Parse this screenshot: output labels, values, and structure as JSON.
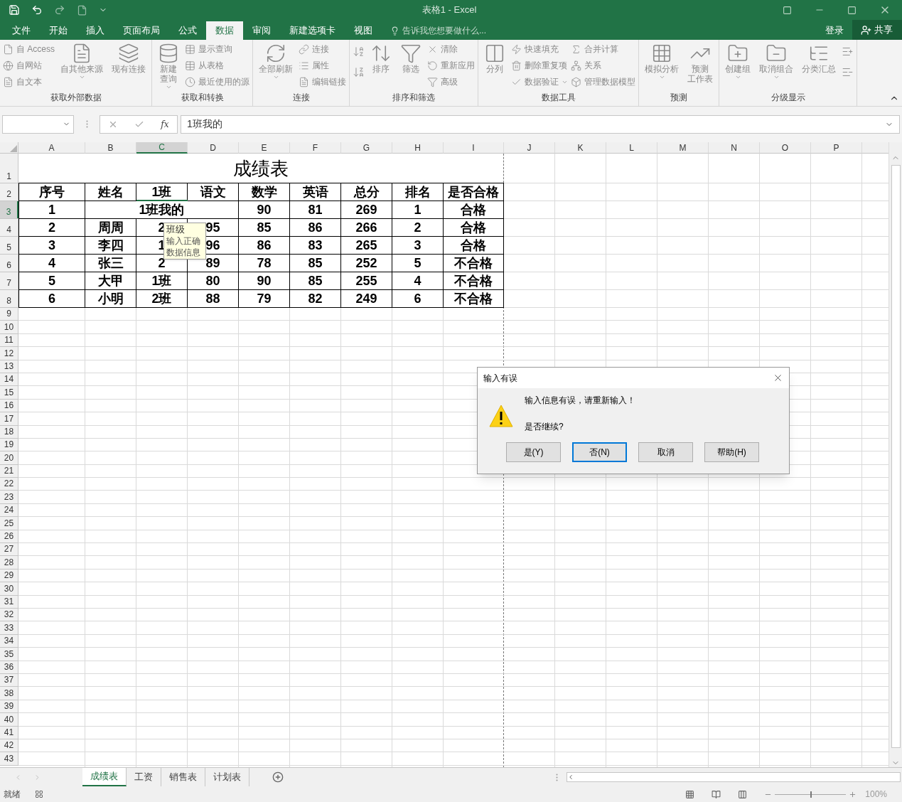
{
  "window": {
    "title": "表格1 - Excel"
  },
  "ribbon_tabs": [
    {
      "label": "文件",
      "selected": false
    },
    {
      "label": "开始",
      "selected": false
    },
    {
      "label": "插入",
      "selected": false
    },
    {
      "label": "页面布局",
      "selected": false
    },
    {
      "label": "公式",
      "selected": false
    },
    {
      "label": "数据",
      "selected": true
    },
    {
      "label": "审阅",
      "selected": false
    },
    {
      "label": "新建选项卡",
      "selected": false
    },
    {
      "label": "视图",
      "selected": false
    }
  ],
  "tell_me": {
    "placeholder": "告诉我您想要做什么..."
  },
  "account": {
    "sign_in": "登录",
    "share": "共享"
  },
  "ribbon_groups": [
    {
      "label": "获取外部数据",
      "items": [
        {
          "kind": "small_stack",
          "items": [
            {
              "label": "自 Access",
              "dropdown": false
            },
            {
              "label": "自网站",
              "dropdown": false
            },
            {
              "label": "自文本",
              "dropdown": false
            }
          ]
        },
        {
          "kind": "large",
          "lines": [
            "自其他来源"
          ],
          "dropdown": true
        },
        {
          "kind": "large",
          "lines": [
            "现有连接"
          ],
          "dropdown": false
        }
      ]
    },
    {
      "label": "获取和转换",
      "items": [
        {
          "kind": "large",
          "lines": [
            "新建",
            "查询"
          ],
          "dropdown": true
        },
        {
          "kind": "small_stack",
          "items": [
            {
              "label": "显示查询",
              "dropdown": false
            },
            {
              "label": "从表格",
              "dropdown": false
            },
            {
              "label": "最近使用的源",
              "dropdown": false
            }
          ]
        }
      ]
    },
    {
      "label": "连接",
      "items": [
        {
          "kind": "large",
          "lines": [
            "全部刷新"
          ],
          "dropdown": true
        },
        {
          "kind": "small_stack",
          "items": [
            {
              "label": "连接",
              "dropdown": false
            },
            {
              "label": "属性",
              "dropdown": false
            },
            {
              "label": "编辑链接",
              "dropdown": false
            }
          ]
        }
      ]
    },
    {
      "label": "排序和筛选",
      "items": [
        {
          "kind": "icon_stack"
        },
        {
          "kind": "large",
          "lines": [
            "排序"
          ],
          "dropdown": false
        },
        {
          "kind": "large",
          "lines": [
            "筛选"
          ],
          "dropdown": false
        },
        {
          "kind": "small_stack",
          "items": [
            {
              "label": "清除",
              "dropdown": false
            },
            {
              "label": "重新应用",
              "dropdown": false
            },
            {
              "label": "高级",
              "dropdown": false
            }
          ]
        }
      ]
    },
    {
      "label": "数据工具",
      "items": [
        {
          "kind": "large",
          "lines": [
            "分列"
          ],
          "dropdown": false
        },
        {
          "kind": "small_stack",
          "items": [
            {
              "label": "快速填充",
              "dropdown": false
            },
            {
              "label": "删除重复项",
              "dropdown": false
            },
            {
              "label": "数据验证",
              "dropdown": true
            }
          ]
        },
        {
          "kind": "small_stack",
          "items": [
            {
              "label": "合并计算",
              "dropdown": false
            },
            {
              "label": "关系",
              "dropdown": false
            },
            {
              "label": "管理数据模型",
              "dropdown": false
            }
          ]
        }
      ]
    },
    {
      "label": "预测",
      "items": [
        {
          "kind": "large",
          "lines": [
            "模拟分析"
          ],
          "dropdown": true
        },
        {
          "kind": "large",
          "lines": [
            "预测",
            "工作表"
          ],
          "dropdown": false
        }
      ]
    },
    {
      "label": "分级显示",
      "items": [
        {
          "kind": "large",
          "lines": [
            "创建组"
          ],
          "dropdown": true
        },
        {
          "kind": "large",
          "lines": [
            "取消组合"
          ],
          "dropdown": true
        },
        {
          "kind": "large",
          "lines": [
            "分类汇总"
          ],
          "dropdown": false
        },
        {
          "kind": "icon_stack"
        }
      ]
    }
  ],
  "formula_bar": {
    "function_label": "fx",
    "value": "1班我的"
  },
  "columns": [
    {
      "label": "A",
      "selected": false
    },
    {
      "label": "B",
      "selected": false
    },
    {
      "label": "C",
      "selected": true
    },
    {
      "label": "D",
      "selected": false
    },
    {
      "label": "E",
      "selected": false
    },
    {
      "label": "F",
      "selected": false
    },
    {
      "label": "G",
      "selected": false
    },
    {
      "label": "H",
      "selected": false
    },
    {
      "label": "I",
      "selected": false
    },
    {
      "label": "J",
      "selected": false
    },
    {
      "label": "K",
      "selected": false
    },
    {
      "label": "L",
      "selected": false
    },
    {
      "label": "M",
      "selected": false
    },
    {
      "label": "N",
      "selected": false
    },
    {
      "label": "O",
      "selected": false
    },
    {
      "label": "P",
      "selected": false
    }
  ],
  "row_numbers": [
    {
      "label": "1",
      "selected": false
    },
    {
      "label": "2",
      "selected": false
    },
    {
      "label": "3",
      "selected": true
    },
    {
      "label": "4",
      "selected": false
    },
    {
      "label": "5",
      "selected": false
    },
    {
      "label": "6",
      "selected": false
    },
    {
      "label": "7",
      "selected": false
    },
    {
      "label": "8",
      "selected": false
    },
    {
      "label": "9",
      "selected": false
    },
    {
      "label": "10",
      "selected": false
    },
    {
      "label": "11",
      "selected": false
    },
    {
      "label": "12",
      "selected": false
    },
    {
      "label": "13",
      "selected": false
    },
    {
      "label": "14",
      "selected": false
    },
    {
      "label": "15",
      "selected": false
    },
    {
      "label": "16",
      "selected": false
    },
    {
      "label": "17",
      "selected": false
    },
    {
      "label": "18",
      "selected": false
    },
    {
      "label": "19",
      "selected": false
    },
    {
      "label": "20",
      "selected": false
    },
    {
      "label": "21",
      "selected": false
    },
    {
      "label": "22",
      "selected": false
    },
    {
      "label": "23",
      "selected": false
    },
    {
      "label": "24",
      "selected": false
    },
    {
      "label": "25",
      "selected": false
    },
    {
      "label": "26",
      "selected": false
    },
    {
      "label": "27",
      "selected": false
    },
    {
      "label": "28",
      "selected": false
    },
    {
      "label": "29",
      "selected": false
    },
    {
      "label": "30",
      "selected": false
    },
    {
      "label": "31",
      "selected": false
    },
    {
      "label": "32",
      "selected": false
    },
    {
      "label": "33",
      "selected": false
    },
    {
      "label": "34",
      "selected": false
    },
    {
      "label": "35",
      "selected": false
    },
    {
      "label": "36",
      "selected": false
    },
    {
      "label": "37",
      "selected": false
    },
    {
      "label": "38",
      "selected": false
    },
    {
      "label": "39",
      "selected": false
    },
    {
      "label": "40",
      "selected": false
    },
    {
      "label": "41",
      "selected": false
    },
    {
      "label": "42",
      "selected": false
    },
    {
      "label": "43",
      "selected": false
    }
  ],
  "table": {
    "title": "成绩表",
    "header": [
      "序号",
      "姓名",
      "1班",
      "语文",
      "数学",
      "英语",
      "总分",
      "排名",
      "是否合格"
    ],
    "rows": [
      [
        {
          "text": "1",
          "kind": "plain"
        },
        {
          "text": "",
          "kind": "plain"
        },
        {
          "text": "1班我的",
          "kind": "spill"
        },
        {
          "text": "",
          "kind": "plain"
        },
        {
          "text": "90",
          "kind": "plain"
        },
        {
          "text": "81",
          "kind": "plain"
        },
        {
          "text": "269",
          "kind": "plain"
        },
        {
          "text": "1",
          "kind": "plain"
        },
        {
          "text": "合格",
          "kind": "plain"
        }
      ],
      [
        {
          "text": "2",
          "kind": "plain"
        },
        {
          "text": "周周",
          "kind": "plain"
        },
        {
          "text": "2",
          "kind": "plain"
        },
        {
          "text": "95",
          "kind": "plain"
        },
        {
          "text": "85",
          "kind": "plain"
        },
        {
          "text": "86",
          "kind": "plain"
        },
        {
          "text": "266",
          "kind": "plain"
        },
        {
          "text": "2",
          "kind": "plain"
        },
        {
          "text": "合格",
          "kind": "plain"
        }
      ],
      [
        {
          "text": "3",
          "kind": "plain"
        },
        {
          "text": "李四",
          "kind": "plain"
        },
        {
          "text": "1",
          "kind": "plain"
        },
        {
          "text": "96",
          "kind": "plain"
        },
        {
          "text": "86",
          "kind": "plain"
        },
        {
          "text": "83",
          "kind": "plain"
        },
        {
          "text": "265",
          "kind": "plain"
        },
        {
          "text": "3",
          "kind": "plain"
        },
        {
          "text": "合格",
          "kind": "plain"
        }
      ],
      [
        {
          "text": "4",
          "kind": "plain"
        },
        {
          "text": "张三",
          "kind": "plain"
        },
        {
          "text": "2",
          "kind": "plain"
        },
        {
          "text": "89",
          "kind": "plain"
        },
        {
          "text": "78",
          "kind": "plain"
        },
        {
          "text": "85",
          "kind": "plain"
        },
        {
          "text": "252",
          "kind": "plain"
        },
        {
          "text": "5",
          "kind": "plain"
        },
        {
          "text": "不合格",
          "kind": "plain"
        }
      ],
      [
        {
          "text": "5",
          "kind": "plain"
        },
        {
          "text": "大甲",
          "kind": "plain"
        },
        {
          "text": "1班",
          "kind": "plain"
        },
        {
          "text": "80",
          "kind": "plain"
        },
        {
          "text": "90",
          "kind": "plain"
        },
        {
          "text": "85",
          "kind": "plain"
        },
        {
          "text": "255",
          "kind": "plain"
        },
        {
          "text": "4",
          "kind": "plain"
        },
        {
          "text": "不合格",
          "kind": "plain"
        }
      ],
      [
        {
          "text": "6",
          "kind": "plain"
        },
        {
          "text": "小明",
          "kind": "plain"
        },
        {
          "text": "2班",
          "kind": "plain"
        },
        {
          "text": "88",
          "kind": "plain"
        },
        {
          "text": "79",
          "kind": "plain"
        },
        {
          "text": "82",
          "kind": "plain"
        },
        {
          "text": "249",
          "kind": "plain"
        },
        {
          "text": "6",
          "kind": "plain"
        },
        {
          "text": "不合格",
          "kind": "plain"
        }
      ]
    ]
  },
  "input_tooltip": {
    "title": "班级",
    "body": "输入正确数据信息"
  },
  "dialog": {
    "title": "输入有误",
    "message": "输入信息有误，请重新输入！",
    "question": "是否继续?",
    "buttons": [
      {
        "label": "是(Y)",
        "selected": false
      },
      {
        "label": "否(N)",
        "selected": true
      },
      {
        "label": "取消",
        "selected": false
      },
      {
        "label": "帮助(H)",
        "selected": false
      }
    ]
  },
  "sheet_tabs": [
    {
      "label": "成绩表",
      "selected": true
    },
    {
      "label": "工资",
      "selected": false
    },
    {
      "label": "销售表",
      "selected": false
    },
    {
      "label": "计划表",
      "selected": false
    }
  ],
  "status_bar": {
    "status": "就绪",
    "zoom_slider": {
      "level": 0.5
    },
    "zoom": "100%"
  }
}
